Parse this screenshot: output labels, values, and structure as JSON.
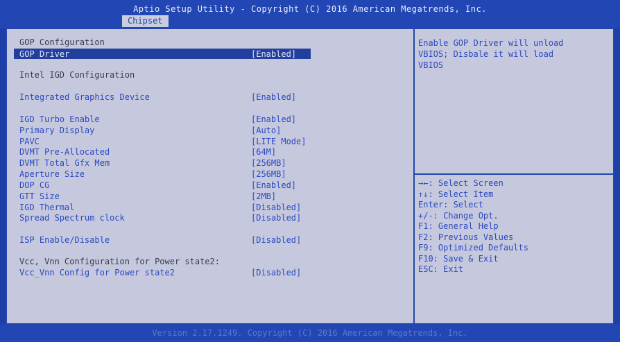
{
  "header": {
    "title": "Aptio Setup Utility - Copyright (C) 2016 American Megatrends, Inc.",
    "active_tab": "Chipset"
  },
  "section": {
    "gop_heading": "GOP Configuration",
    "igd_heading": "Intel IGD Configuration",
    "vcc_heading": "Vcc, Vnn Configuration for Power state2:"
  },
  "settings": [
    {
      "label": "GOP Driver",
      "value": "[Enabled]"
    },
    {
      "label": "Integrated Graphics Device",
      "value": "[Enabled]"
    },
    {
      "label": "IGD Turbo Enable",
      "value": "[Enabled]"
    },
    {
      "label": "Primary Display",
      "value": "[Auto]"
    },
    {
      "label": "PAVC",
      "value": "[LITE Mode]"
    },
    {
      "label": "DVMT Pre-Allocated",
      "value": "[64M]"
    },
    {
      "label": "DVMT Total Gfx Mem",
      "value": "[256MB]"
    },
    {
      "label": "Aperture Size",
      "value": "[256MB]"
    },
    {
      "label": "DOP CG",
      "value": "[Enabled]"
    },
    {
      "label": "GTT Size",
      "value": "[2MB]"
    },
    {
      "label": "IGD Thermal",
      "value": "[Disabled]"
    },
    {
      "label": "Spread Spectrum clock",
      "value": "[Disabled]"
    },
    {
      "label": "ISP Enable/Disable",
      "value": "[Disabled]"
    },
    {
      "label": "Vcc_Vnn Config for Power state2",
      "value": "[Disabled]"
    }
  ],
  "help": {
    "lines": [
      "Enable GOP Driver will unload",
      "VBIOS; Disbale it will load",
      "VBIOS"
    ]
  },
  "keys": [
    "→←: Select Screen",
    "↑↓: Select Item",
    "Enter: Select",
    "+/-: Change Opt.",
    "F1: General Help",
    "F2: Previous Values",
    "F9: Optimized Defaults",
    "F10: Save & Exit",
    "ESC: Exit"
  ],
  "footer": {
    "text": "Version 2.17.1249. Copyright (C) 2016 American Megatrends, Inc."
  },
  "colors": {
    "background": "#1d3fa8",
    "panel": "#c6c9dd",
    "setting_text": "#2b49c1",
    "heading_text": "#3a3a50",
    "selection": "#233f9d"
  }
}
